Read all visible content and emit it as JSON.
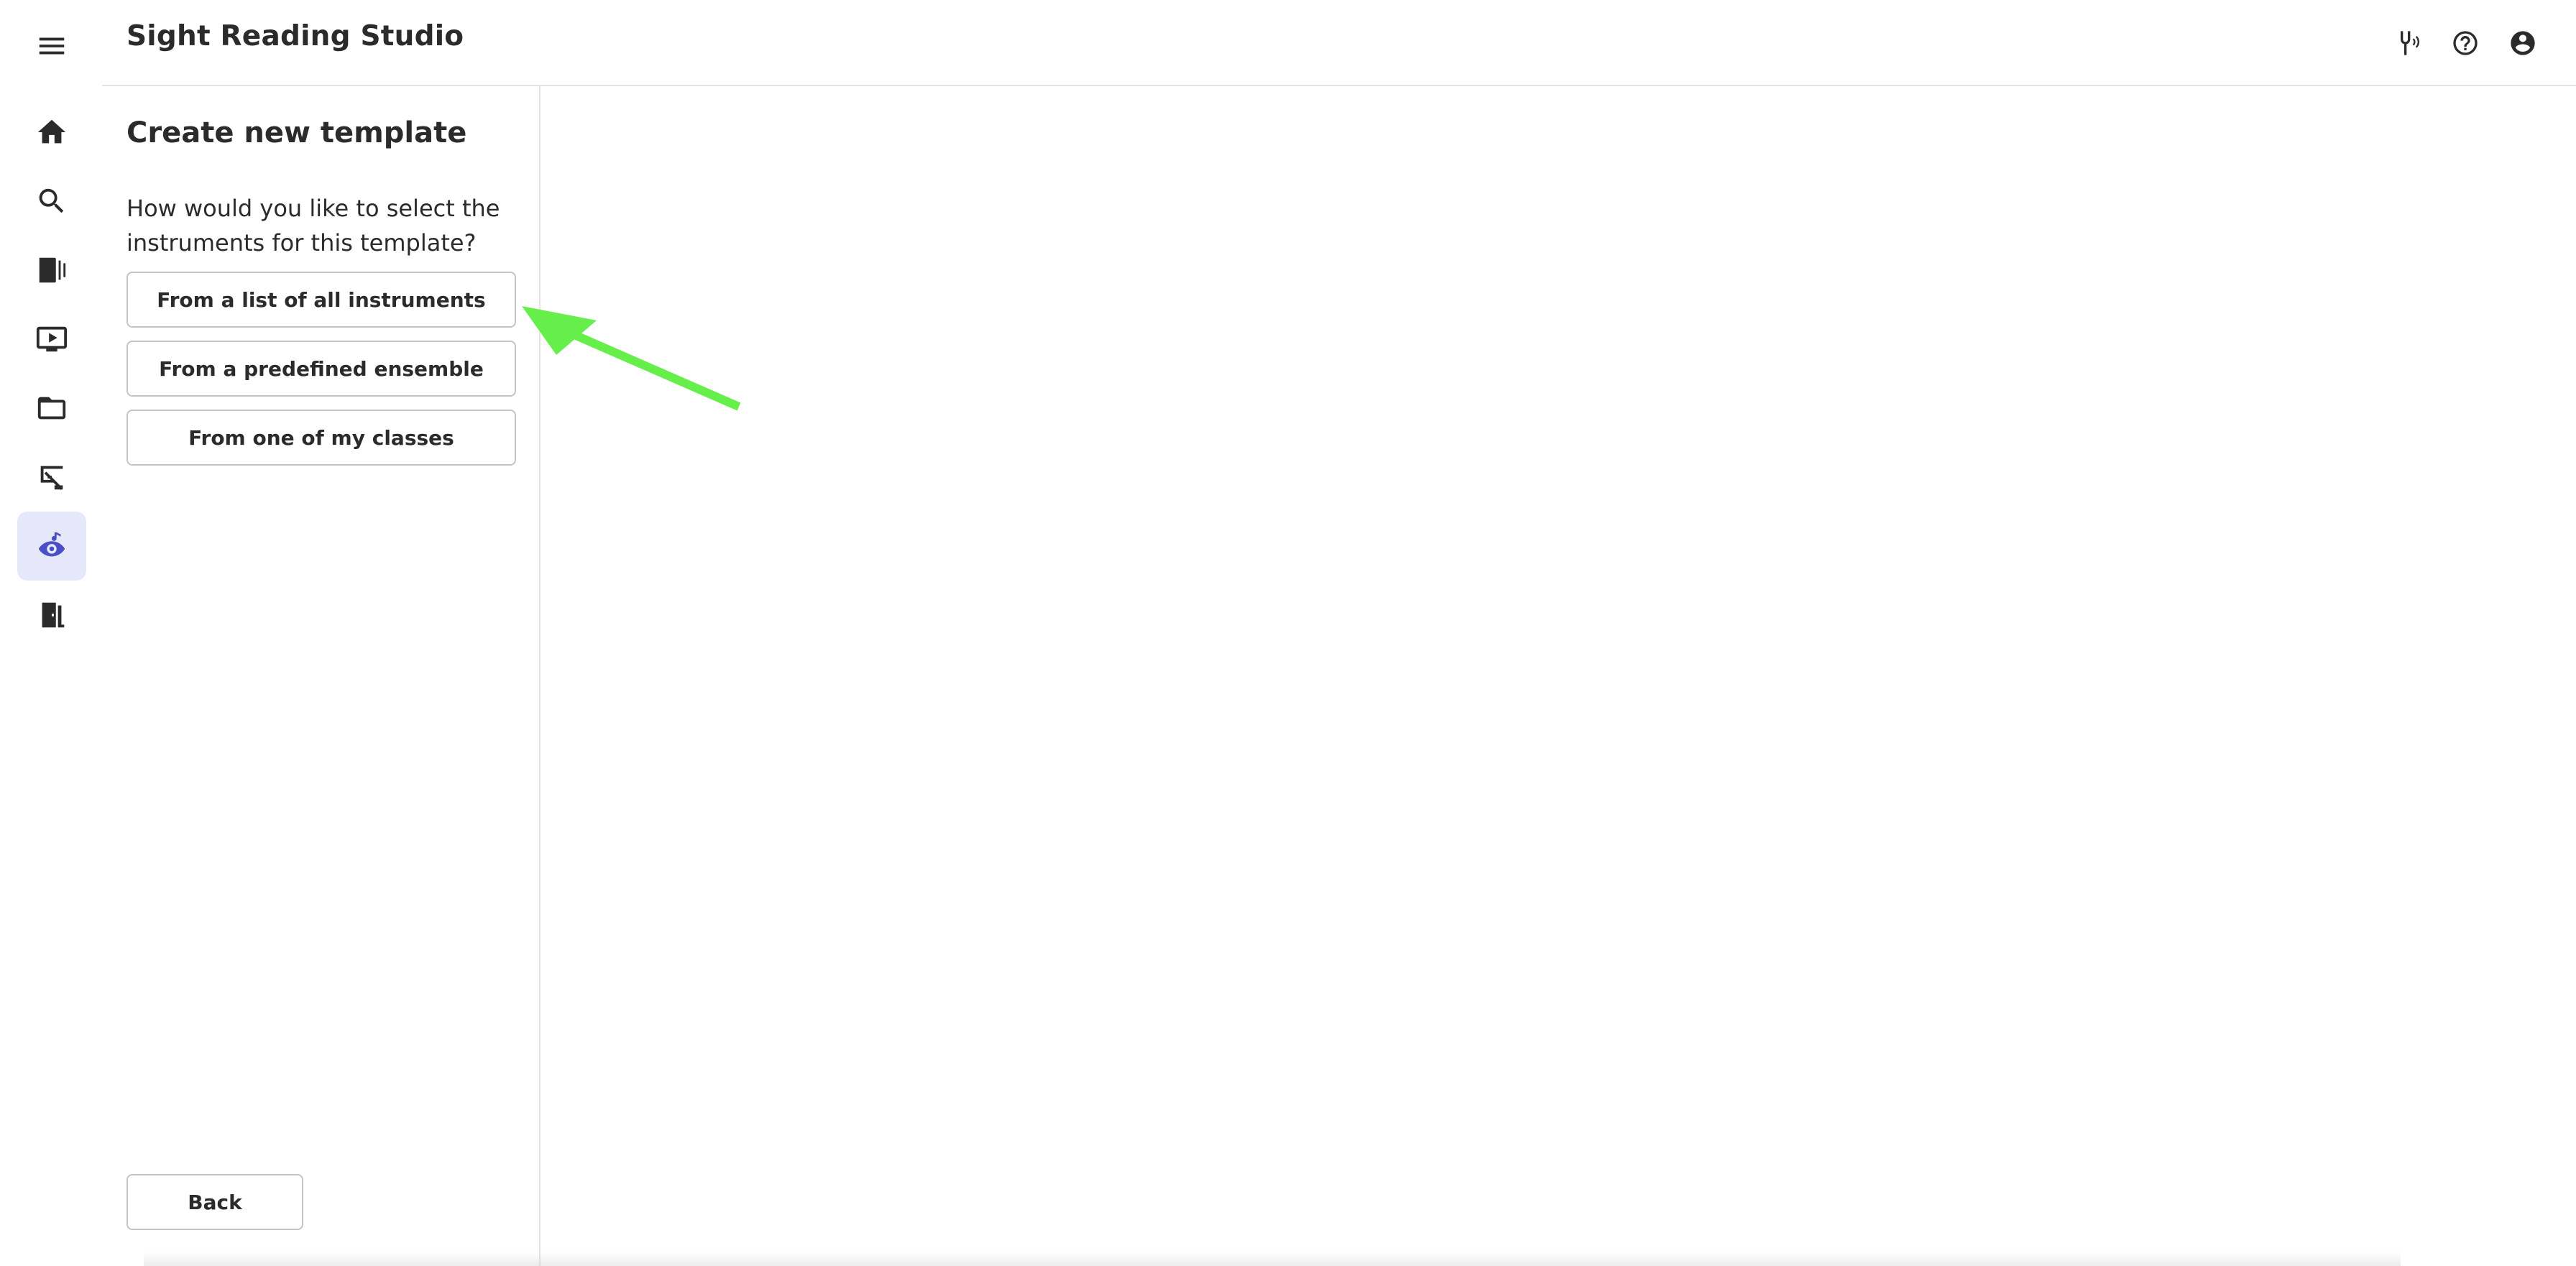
{
  "header": {
    "title": "Sight Reading Studio",
    "icons": [
      "tuning-fork-icon",
      "help-icon",
      "account-icon"
    ]
  },
  "rail": {
    "items": [
      {
        "icon": "menu-icon"
      },
      {
        "icon": "home-icon"
      },
      {
        "icon": "search-icon"
      },
      {
        "icon": "library-icon"
      },
      {
        "icon": "video-icon"
      },
      {
        "icon": "folder-icon"
      },
      {
        "icon": "classes-icon"
      },
      {
        "icon": "sight-reading-icon",
        "active": true
      },
      {
        "icon": "exit-icon"
      }
    ],
    "active_color": "#4a4fc4",
    "active_bg": "#e6e8fa"
  },
  "panel": {
    "title": "Create new template",
    "question": "How would you like to select the instruments for this template?",
    "options": [
      "From a list of all instruments",
      "From a predefined ensemble",
      "From one of my classes"
    ],
    "back_label": "Back"
  },
  "annotation": {
    "color": "#66ee4a"
  }
}
